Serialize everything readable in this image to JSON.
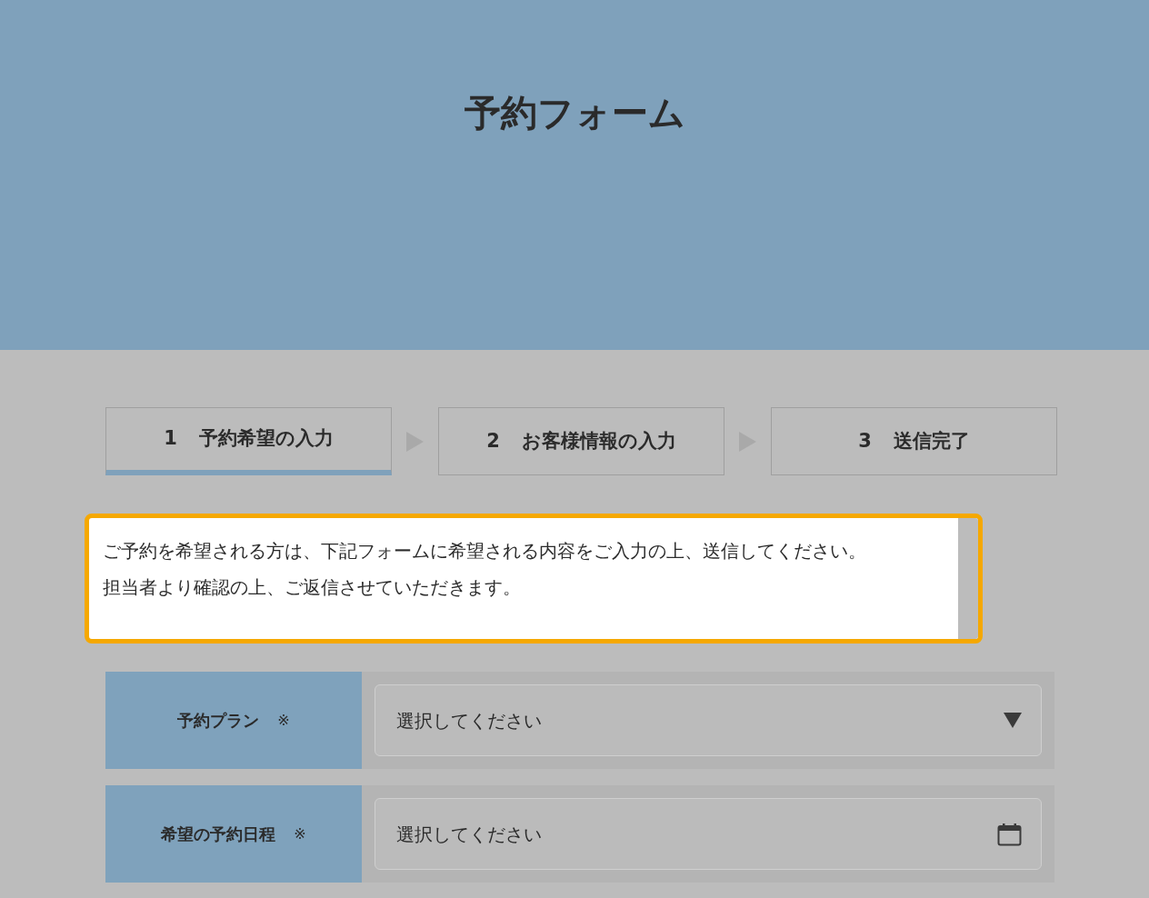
{
  "header": {
    "title": "予約フォーム"
  },
  "steps": [
    {
      "number": "1",
      "label": "予約希望の入力",
      "selected": true
    },
    {
      "number": "2",
      "label": "お客様情報の入力",
      "selected": false
    },
    {
      "number": "3",
      "label": "送信完了",
      "selected": false
    }
  ],
  "notice": {
    "lines": [
      "ご予約を希望される方は、下記フォームに希望される内容をご入力の上、送信してください。",
      "担当者より確認の上、ご返信させていただきます。"
    ]
  },
  "fields": [
    {
      "label": "予約プラン",
      "required_mark": "※",
      "placeholder": "選択してください",
      "kind": "select"
    },
    {
      "label": "希望の予約日程",
      "required_mark": "※",
      "placeholder": "選択してください",
      "kind": "date"
    }
  ]
}
